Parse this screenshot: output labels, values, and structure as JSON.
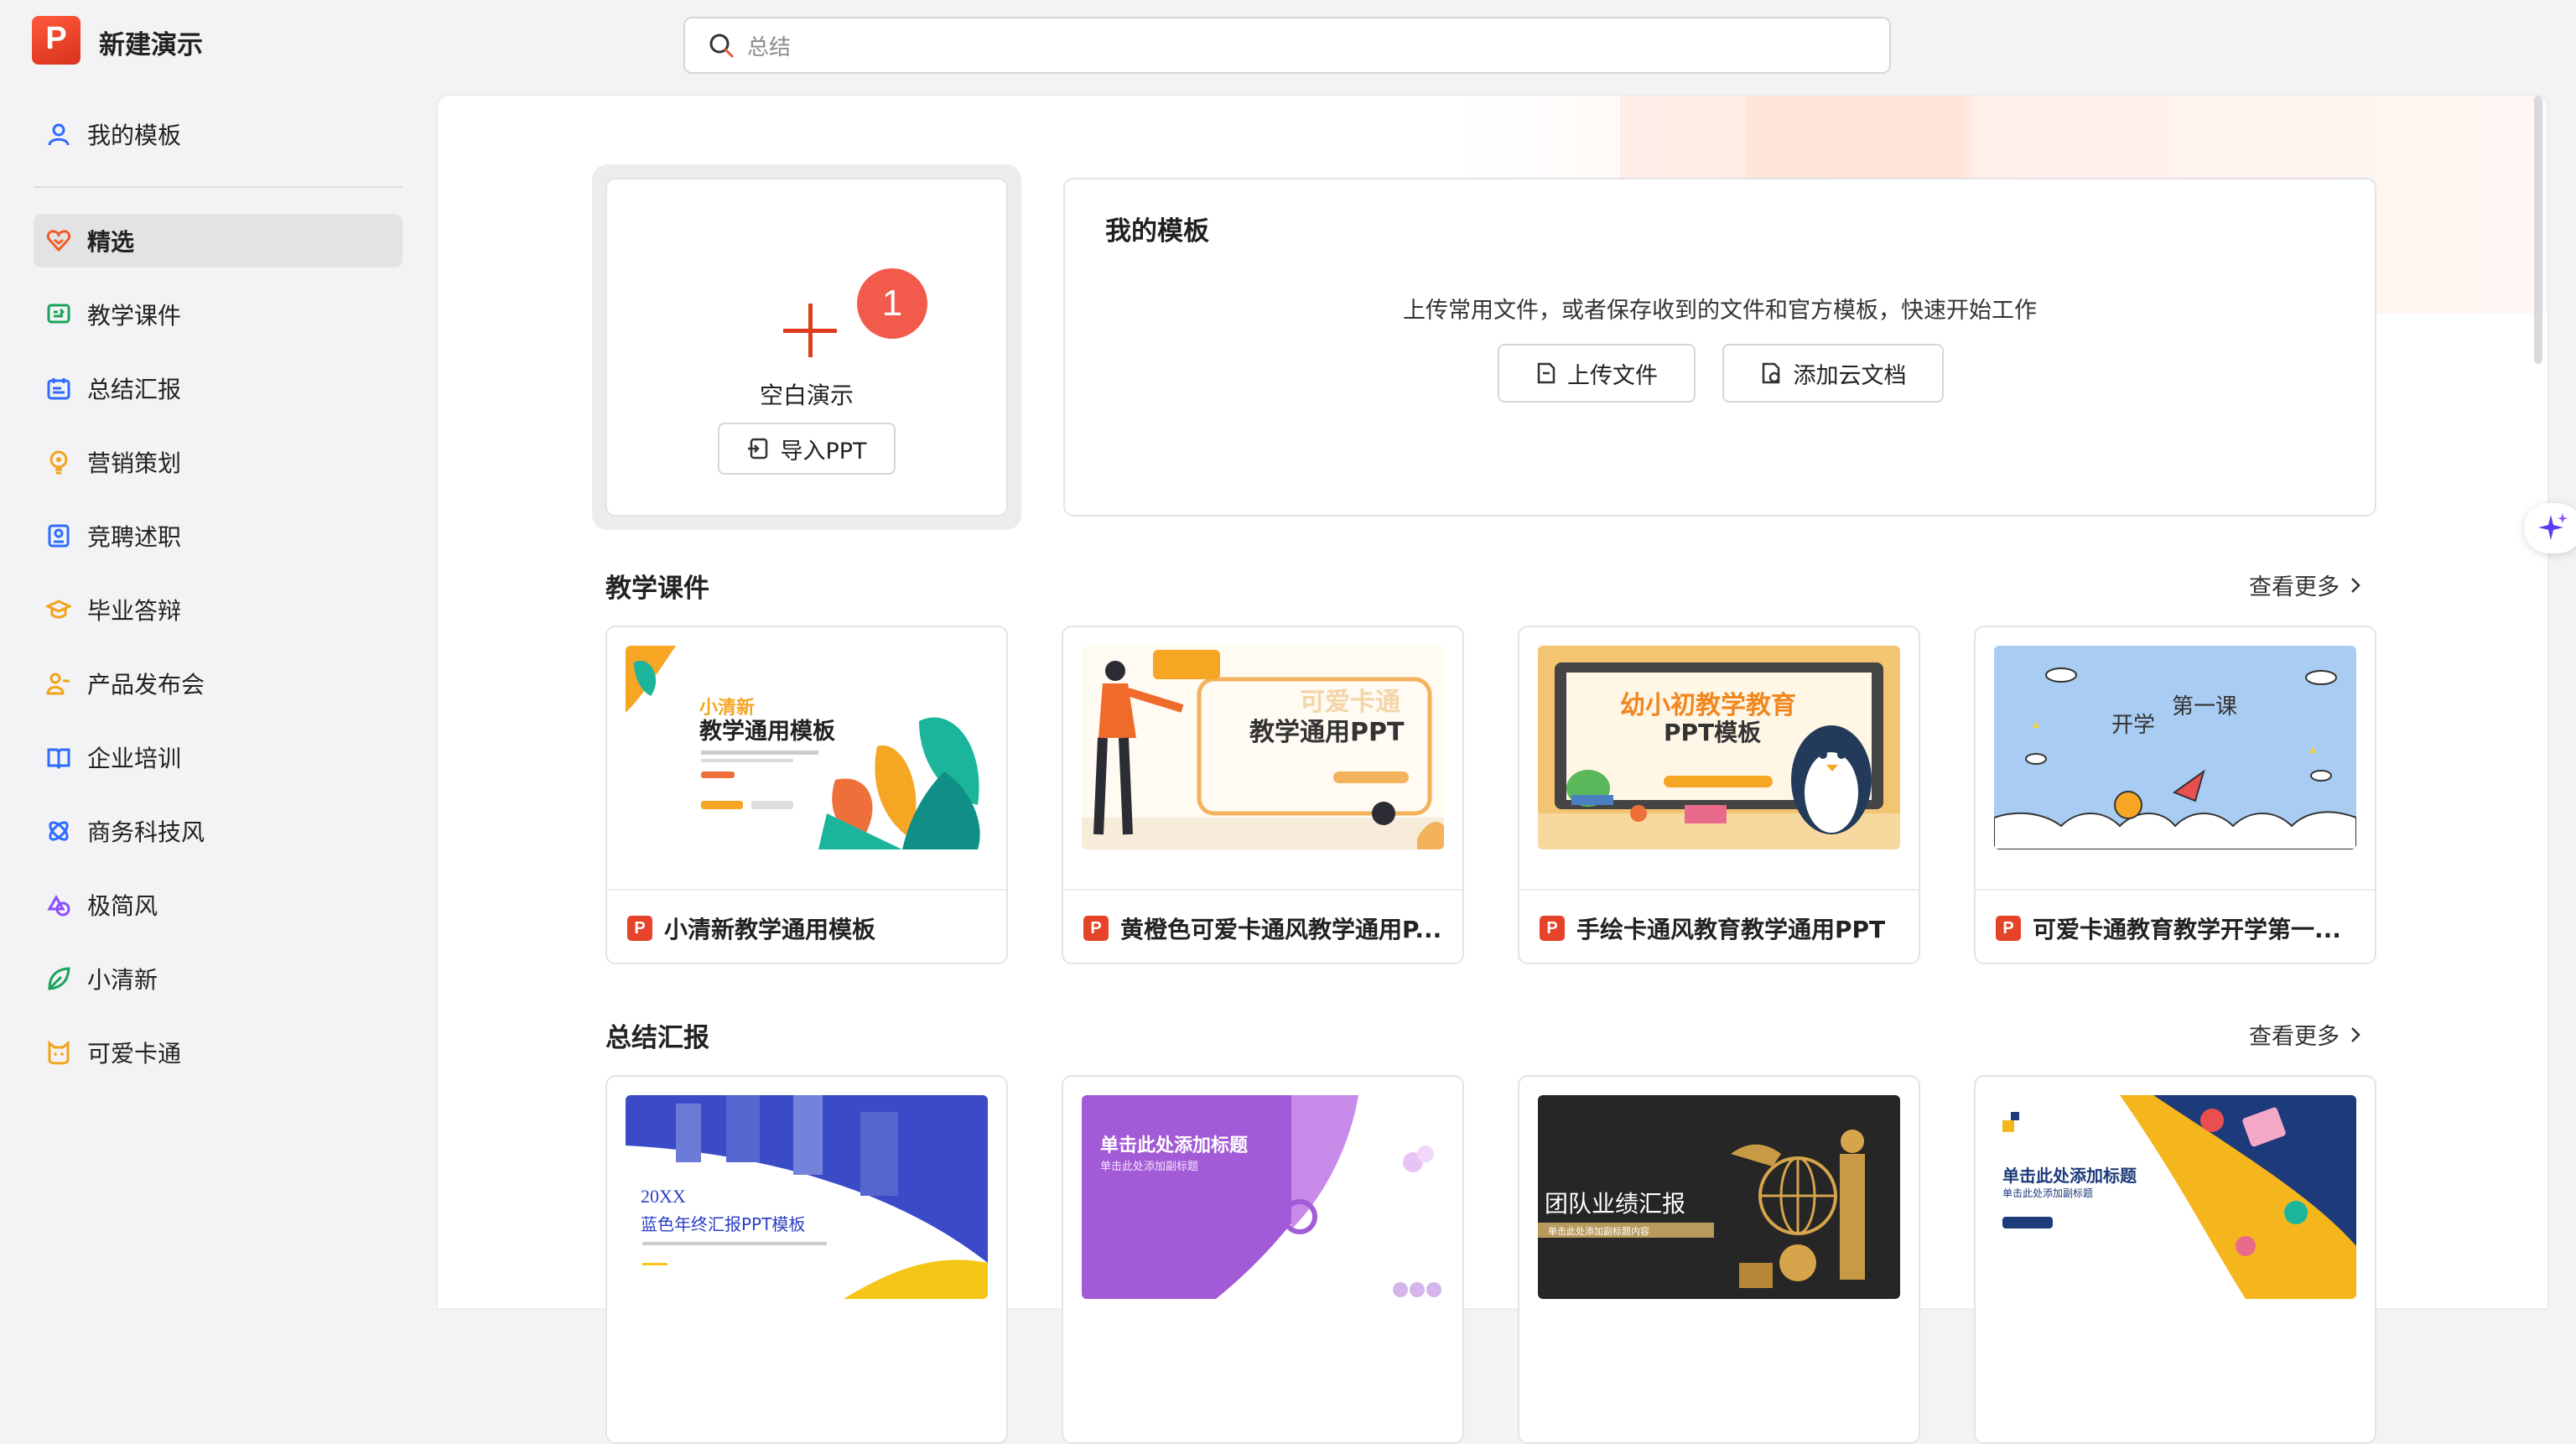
{
  "app": {
    "title": "新建演示",
    "logo_letter": "P"
  },
  "search": {
    "value": "总结"
  },
  "sidebar": {
    "top_item": {
      "label": "我的模板",
      "icon": "user-icon"
    },
    "items": [
      {
        "label": "精选",
        "icon": "heart-icon",
        "active": true
      },
      {
        "label": "教学课件",
        "icon": "courseware-icon"
      },
      {
        "label": "总结汇报",
        "icon": "calendar-icon"
      },
      {
        "label": "营销策划",
        "icon": "lightbulb-icon"
      },
      {
        "label": "竞聘述职",
        "icon": "badge-icon"
      },
      {
        "label": "毕业答辩",
        "icon": "graduation-cap-icon"
      },
      {
        "label": "产品发布会",
        "icon": "presenter-icon"
      },
      {
        "label": "企业培训",
        "icon": "book-icon"
      },
      {
        "label": "商务科技风",
        "icon": "atom-icon"
      },
      {
        "label": "极简风",
        "icon": "shapes-icon"
      },
      {
        "label": "小清新",
        "icon": "leaf-icon"
      },
      {
        "label": "可爱卡通",
        "icon": "cat-icon"
      }
    ]
  },
  "new_card": {
    "label": "空白演示",
    "badge": "1",
    "import_label": "导入PPT"
  },
  "my_templates": {
    "title": "我的模板",
    "description": "上传常用文件，或者保存收到的文件和官方模板，快速开始工作",
    "upload_label": "上传文件",
    "cloud_label": "添加云文档"
  },
  "sections": [
    {
      "title": "教学课件",
      "see_more": "查看更多",
      "cards": [
        {
          "name": "小清新教学通用模板",
          "thumb_title": "教学通用模板",
          "thumb_sub": "小清新"
        },
        {
          "name": "黄橙色可爱卡通风教学通用P...",
          "thumb_title": "教学通用PPT",
          "thumb_sub": "可爱卡通"
        },
        {
          "name": "手绘卡通风教育教学通用PPT",
          "thumb_title": "幼小初教学教育",
          "thumb_sub": "PPT模板"
        },
        {
          "name": "可爱卡通教育教学开学第一...",
          "thumb_title": "开学",
          "thumb_sub": "第一课"
        }
      ]
    },
    {
      "title": "总结汇报",
      "see_more": "查看更多",
      "cards": [
        {
          "thumb_title": "20XX",
          "thumb_sub": "蓝色年终汇报PPT模板"
        },
        {
          "thumb_title": "单击此处添加标题",
          "thumb_sub": "单击此处添加副标题"
        },
        {
          "thumb_title": "团队业绩汇报",
          "thumb_sub": "单击此处添加副标题内容"
        },
        {
          "thumb_title": "单击此处添加标题",
          "thumb_sub": "单击此处添加副标题"
        }
      ]
    }
  ],
  "colors": {
    "brand": "#e03a1f",
    "badge": "#f25a4c",
    "sidebar_active": "#e3e3e6"
  }
}
